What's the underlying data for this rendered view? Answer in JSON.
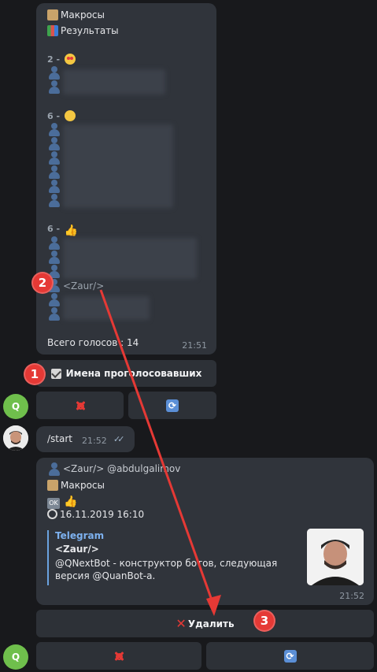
{
  "message1": {
    "line_macros": "Макросы",
    "line_results": "Результаты",
    "group_1_count": "2 -",
    "group_2_count": "6 -",
    "group_3_count": "6 -",
    "visible_voter": "<Zaur/>",
    "total_votes": "Всего голосов : 14",
    "time": "21:51"
  },
  "keyboard1": {
    "voters_button": "Имена проголосовавших"
  },
  "avatar_bot": "Q",
  "message2": {
    "text": "/start",
    "time": "21:52",
    "ticks": "✓✓"
  },
  "message3": {
    "author_line": "<Zaur/> @abdulgalimov",
    "macros": "Макросы",
    "ok": "OK",
    "datetime": "16.11.2019 16:10",
    "preview_site": "Telegram",
    "preview_title": "<Zaur/>",
    "preview_text": "@QNextBot - конструктор ботов, следующая версия @QuanBot-a.",
    "time": "21:52"
  },
  "keyboard2": {
    "delete_button": "Удалить"
  },
  "annotations": {
    "badge_1": "1",
    "badge_2": "2",
    "badge_3": "3"
  },
  "colors": {
    "background": "#18191c",
    "bubble": "#30343b",
    "annotation": "#e53935",
    "link": "#7db1ef"
  }
}
